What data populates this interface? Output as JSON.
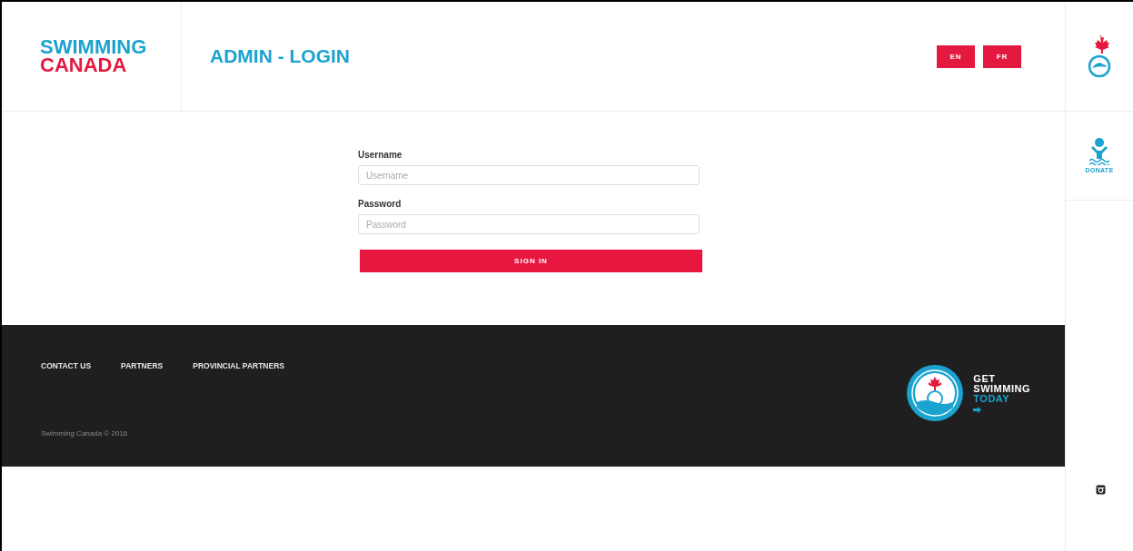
{
  "logo": {
    "line_1": "SWIMMING",
    "line_2": "CANADA"
  },
  "page_title": "ADMIN - LOGIN",
  "languages": [
    {
      "label": "EN"
    },
    {
      "label": "FR"
    }
  ],
  "side_rail": {
    "donate_label": "DONATE"
  },
  "login_form": {
    "fields": [
      {
        "label": "Username",
        "placeholder": "Username"
      },
      {
        "label": "Password",
        "placeholder": "Password"
      }
    ],
    "submit": "SIGN IN"
  },
  "footer": {
    "links": [
      "CONTACT US",
      "PARTNERS",
      "PROVINCIAL PARTNERS"
    ],
    "copyright": "Swimming Canada © 2016",
    "promo": {
      "line_1": "GET",
      "line_2": "SWIMMING",
      "line_3": "TODAY"
    }
  }
}
